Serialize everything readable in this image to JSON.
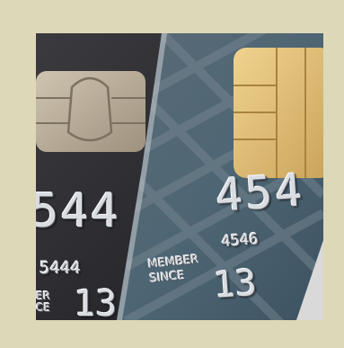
{
  "photo": {
    "left_card": {
      "big_digits": "544",
      "small_digits": "5444",
      "bottom_text": "ER\nCE",
      "bottom_digits": "13"
    },
    "right_card": {
      "big_digits": "454",
      "small_digits": "4546",
      "member_label": "MEMBER",
      "since_label": "SINCE",
      "since_digits": "13"
    }
  },
  "colors": {
    "frame": "#ddd8b8",
    "left_card": "#2b2b30",
    "right_card": "#4f6572",
    "chip_silver": "#b9ad98",
    "chip_gold": "#e3c278"
  }
}
